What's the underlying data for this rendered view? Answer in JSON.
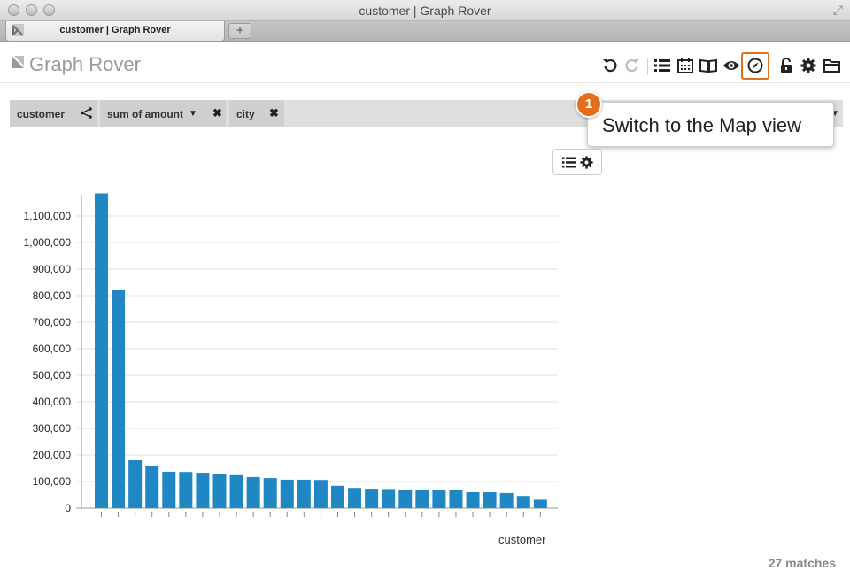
{
  "window": {
    "title": "customer | Graph Rover"
  },
  "tabs": [
    {
      "label": "customer | Graph Rover"
    }
  ],
  "new_tab_label": "+",
  "app": {
    "title": "Graph Rover"
  },
  "toolbar": {
    "icons": [
      "undo-icon",
      "redo-icon",
      "list-view-icon",
      "calendar-view-icon",
      "book-view-icon",
      "eye-view-icon",
      "compass-map-view-icon",
      "lock-icon",
      "gear-icon",
      "folder-icon"
    ],
    "active": "compass-map-view-icon",
    "accent_color": "#e26f1b"
  },
  "filters": [
    {
      "label": "customer",
      "icon": "share-icon"
    },
    {
      "label": "sum of amount",
      "icon": "caret-down-icon",
      "close": "✖"
    },
    {
      "label": "city",
      "close": "✖"
    }
  ],
  "callout": {
    "step": "1",
    "text": "Switch to the Map view"
  },
  "chart_options": {
    "icons": [
      "list-icon",
      "gear-icon"
    ]
  },
  "chart_data": {
    "type": "bar",
    "xlabel": "customer",
    "ylabel": "",
    "ylim": [
      0,
      1180000
    ],
    "yticks": [
      0,
      100000,
      200000,
      300000,
      400000,
      500000,
      600000,
      700000,
      800000,
      900000,
      1000000,
      1100000
    ],
    "ytick_labels": [
      "0",
      "100,000",
      "200,000",
      "300,000",
      "400,000",
      "500,000",
      "600,000",
      "700,000",
      "800,000",
      "900,000",
      "1,000,000",
      "1,100,000"
    ],
    "grid": true,
    "bar_color": "#1f87c3",
    "values": [
      1185000,
      820000,
      180000,
      157000,
      137000,
      136000,
      133000,
      130000,
      124000,
      117000,
      113000,
      107000,
      107000,
      106000,
      84000,
      76000,
      73000,
      72000,
      70000,
      70000,
      70000,
      69000,
      60000,
      60000,
      57000,
      46000,
      32000
    ]
  },
  "status": {
    "matches": "27 matches"
  }
}
